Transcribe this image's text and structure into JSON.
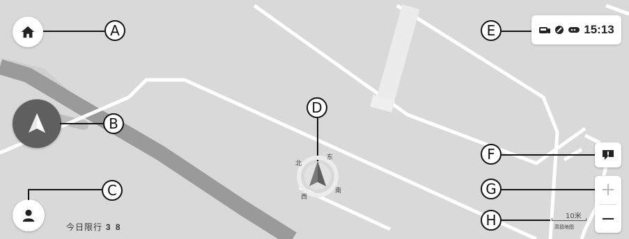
{
  "status_bar": {
    "time": "15:13",
    "icons": [
      "vehicle-icon",
      "signal-icon",
      "battery-icon"
    ]
  },
  "buttons": {
    "home_icon": "home-icon",
    "locate_icon": "navigation-arrow-icon",
    "profile_icon": "person-icon",
    "report_icon": "alert-icon",
    "zoom_in": "+",
    "zoom_out": "−"
  },
  "restriction": {
    "label": "今日限行",
    "numbers": "3 8"
  },
  "compass": {
    "north": "北",
    "east": "东",
    "south": "南",
    "west": "西"
  },
  "scale": {
    "distance": "10米",
    "provider": "高德地图"
  },
  "callouts": [
    "A",
    "B",
    "C",
    "D",
    "E",
    "F",
    "G",
    "H"
  ],
  "colors": {
    "map_background": "#d9d9d9",
    "road_white": "#ffffff",
    "major_road": "#9a9a9a",
    "locate_button": "#5f5f5f"
  }
}
